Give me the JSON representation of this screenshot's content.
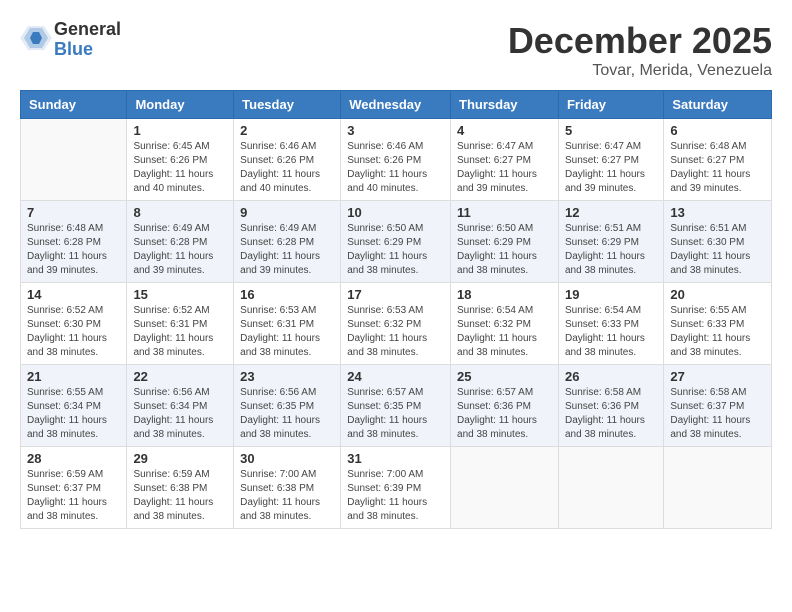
{
  "logo": {
    "general": "General",
    "blue": "Blue"
  },
  "title": "December 2025",
  "location": "Tovar, Merida, Venezuela",
  "weekdays": [
    "Sunday",
    "Monday",
    "Tuesday",
    "Wednesday",
    "Thursday",
    "Friday",
    "Saturday"
  ],
  "weeks": [
    [
      {
        "day": "",
        "sunrise": "",
        "sunset": "",
        "daylight": ""
      },
      {
        "day": "1",
        "sunrise": "Sunrise: 6:45 AM",
        "sunset": "Sunset: 6:26 PM",
        "daylight": "Daylight: 11 hours and 40 minutes."
      },
      {
        "day": "2",
        "sunrise": "Sunrise: 6:46 AM",
        "sunset": "Sunset: 6:26 PM",
        "daylight": "Daylight: 11 hours and 40 minutes."
      },
      {
        "day": "3",
        "sunrise": "Sunrise: 6:46 AM",
        "sunset": "Sunset: 6:26 PM",
        "daylight": "Daylight: 11 hours and 40 minutes."
      },
      {
        "day": "4",
        "sunrise": "Sunrise: 6:47 AM",
        "sunset": "Sunset: 6:27 PM",
        "daylight": "Daylight: 11 hours and 39 minutes."
      },
      {
        "day": "5",
        "sunrise": "Sunrise: 6:47 AM",
        "sunset": "Sunset: 6:27 PM",
        "daylight": "Daylight: 11 hours and 39 minutes."
      },
      {
        "day": "6",
        "sunrise": "Sunrise: 6:48 AM",
        "sunset": "Sunset: 6:27 PM",
        "daylight": "Daylight: 11 hours and 39 minutes."
      }
    ],
    [
      {
        "day": "7",
        "sunrise": "Sunrise: 6:48 AM",
        "sunset": "Sunset: 6:28 PM",
        "daylight": "Daylight: 11 hours and 39 minutes."
      },
      {
        "day": "8",
        "sunrise": "Sunrise: 6:49 AM",
        "sunset": "Sunset: 6:28 PM",
        "daylight": "Daylight: 11 hours and 39 minutes."
      },
      {
        "day": "9",
        "sunrise": "Sunrise: 6:49 AM",
        "sunset": "Sunset: 6:28 PM",
        "daylight": "Daylight: 11 hours and 39 minutes."
      },
      {
        "day": "10",
        "sunrise": "Sunrise: 6:50 AM",
        "sunset": "Sunset: 6:29 PM",
        "daylight": "Daylight: 11 hours and 38 minutes."
      },
      {
        "day": "11",
        "sunrise": "Sunrise: 6:50 AM",
        "sunset": "Sunset: 6:29 PM",
        "daylight": "Daylight: 11 hours and 38 minutes."
      },
      {
        "day": "12",
        "sunrise": "Sunrise: 6:51 AM",
        "sunset": "Sunset: 6:29 PM",
        "daylight": "Daylight: 11 hours and 38 minutes."
      },
      {
        "day": "13",
        "sunrise": "Sunrise: 6:51 AM",
        "sunset": "Sunset: 6:30 PM",
        "daylight": "Daylight: 11 hours and 38 minutes."
      }
    ],
    [
      {
        "day": "14",
        "sunrise": "Sunrise: 6:52 AM",
        "sunset": "Sunset: 6:30 PM",
        "daylight": "Daylight: 11 hours and 38 minutes."
      },
      {
        "day": "15",
        "sunrise": "Sunrise: 6:52 AM",
        "sunset": "Sunset: 6:31 PM",
        "daylight": "Daylight: 11 hours and 38 minutes."
      },
      {
        "day": "16",
        "sunrise": "Sunrise: 6:53 AM",
        "sunset": "Sunset: 6:31 PM",
        "daylight": "Daylight: 11 hours and 38 minutes."
      },
      {
        "day": "17",
        "sunrise": "Sunrise: 6:53 AM",
        "sunset": "Sunset: 6:32 PM",
        "daylight": "Daylight: 11 hours and 38 minutes."
      },
      {
        "day": "18",
        "sunrise": "Sunrise: 6:54 AM",
        "sunset": "Sunset: 6:32 PM",
        "daylight": "Daylight: 11 hours and 38 minutes."
      },
      {
        "day": "19",
        "sunrise": "Sunrise: 6:54 AM",
        "sunset": "Sunset: 6:33 PM",
        "daylight": "Daylight: 11 hours and 38 minutes."
      },
      {
        "day": "20",
        "sunrise": "Sunrise: 6:55 AM",
        "sunset": "Sunset: 6:33 PM",
        "daylight": "Daylight: 11 hours and 38 minutes."
      }
    ],
    [
      {
        "day": "21",
        "sunrise": "Sunrise: 6:55 AM",
        "sunset": "Sunset: 6:34 PM",
        "daylight": "Daylight: 11 hours and 38 minutes."
      },
      {
        "day": "22",
        "sunrise": "Sunrise: 6:56 AM",
        "sunset": "Sunset: 6:34 PM",
        "daylight": "Daylight: 11 hours and 38 minutes."
      },
      {
        "day": "23",
        "sunrise": "Sunrise: 6:56 AM",
        "sunset": "Sunset: 6:35 PM",
        "daylight": "Daylight: 11 hours and 38 minutes."
      },
      {
        "day": "24",
        "sunrise": "Sunrise: 6:57 AM",
        "sunset": "Sunset: 6:35 PM",
        "daylight": "Daylight: 11 hours and 38 minutes."
      },
      {
        "day": "25",
        "sunrise": "Sunrise: 6:57 AM",
        "sunset": "Sunset: 6:36 PM",
        "daylight": "Daylight: 11 hours and 38 minutes."
      },
      {
        "day": "26",
        "sunrise": "Sunrise: 6:58 AM",
        "sunset": "Sunset: 6:36 PM",
        "daylight": "Daylight: 11 hours and 38 minutes."
      },
      {
        "day": "27",
        "sunrise": "Sunrise: 6:58 AM",
        "sunset": "Sunset: 6:37 PM",
        "daylight": "Daylight: 11 hours and 38 minutes."
      }
    ],
    [
      {
        "day": "28",
        "sunrise": "Sunrise: 6:59 AM",
        "sunset": "Sunset: 6:37 PM",
        "daylight": "Daylight: 11 hours and 38 minutes."
      },
      {
        "day": "29",
        "sunrise": "Sunrise: 6:59 AM",
        "sunset": "Sunset: 6:38 PM",
        "daylight": "Daylight: 11 hours and 38 minutes."
      },
      {
        "day": "30",
        "sunrise": "Sunrise: 7:00 AM",
        "sunset": "Sunset: 6:38 PM",
        "daylight": "Daylight: 11 hours and 38 minutes."
      },
      {
        "day": "31",
        "sunrise": "Sunrise: 7:00 AM",
        "sunset": "Sunset: 6:39 PM",
        "daylight": "Daylight: 11 hours and 38 minutes."
      },
      {
        "day": "",
        "sunrise": "",
        "sunset": "",
        "daylight": ""
      },
      {
        "day": "",
        "sunrise": "",
        "sunset": "",
        "daylight": ""
      },
      {
        "day": "",
        "sunrise": "",
        "sunset": "",
        "daylight": ""
      }
    ]
  ]
}
